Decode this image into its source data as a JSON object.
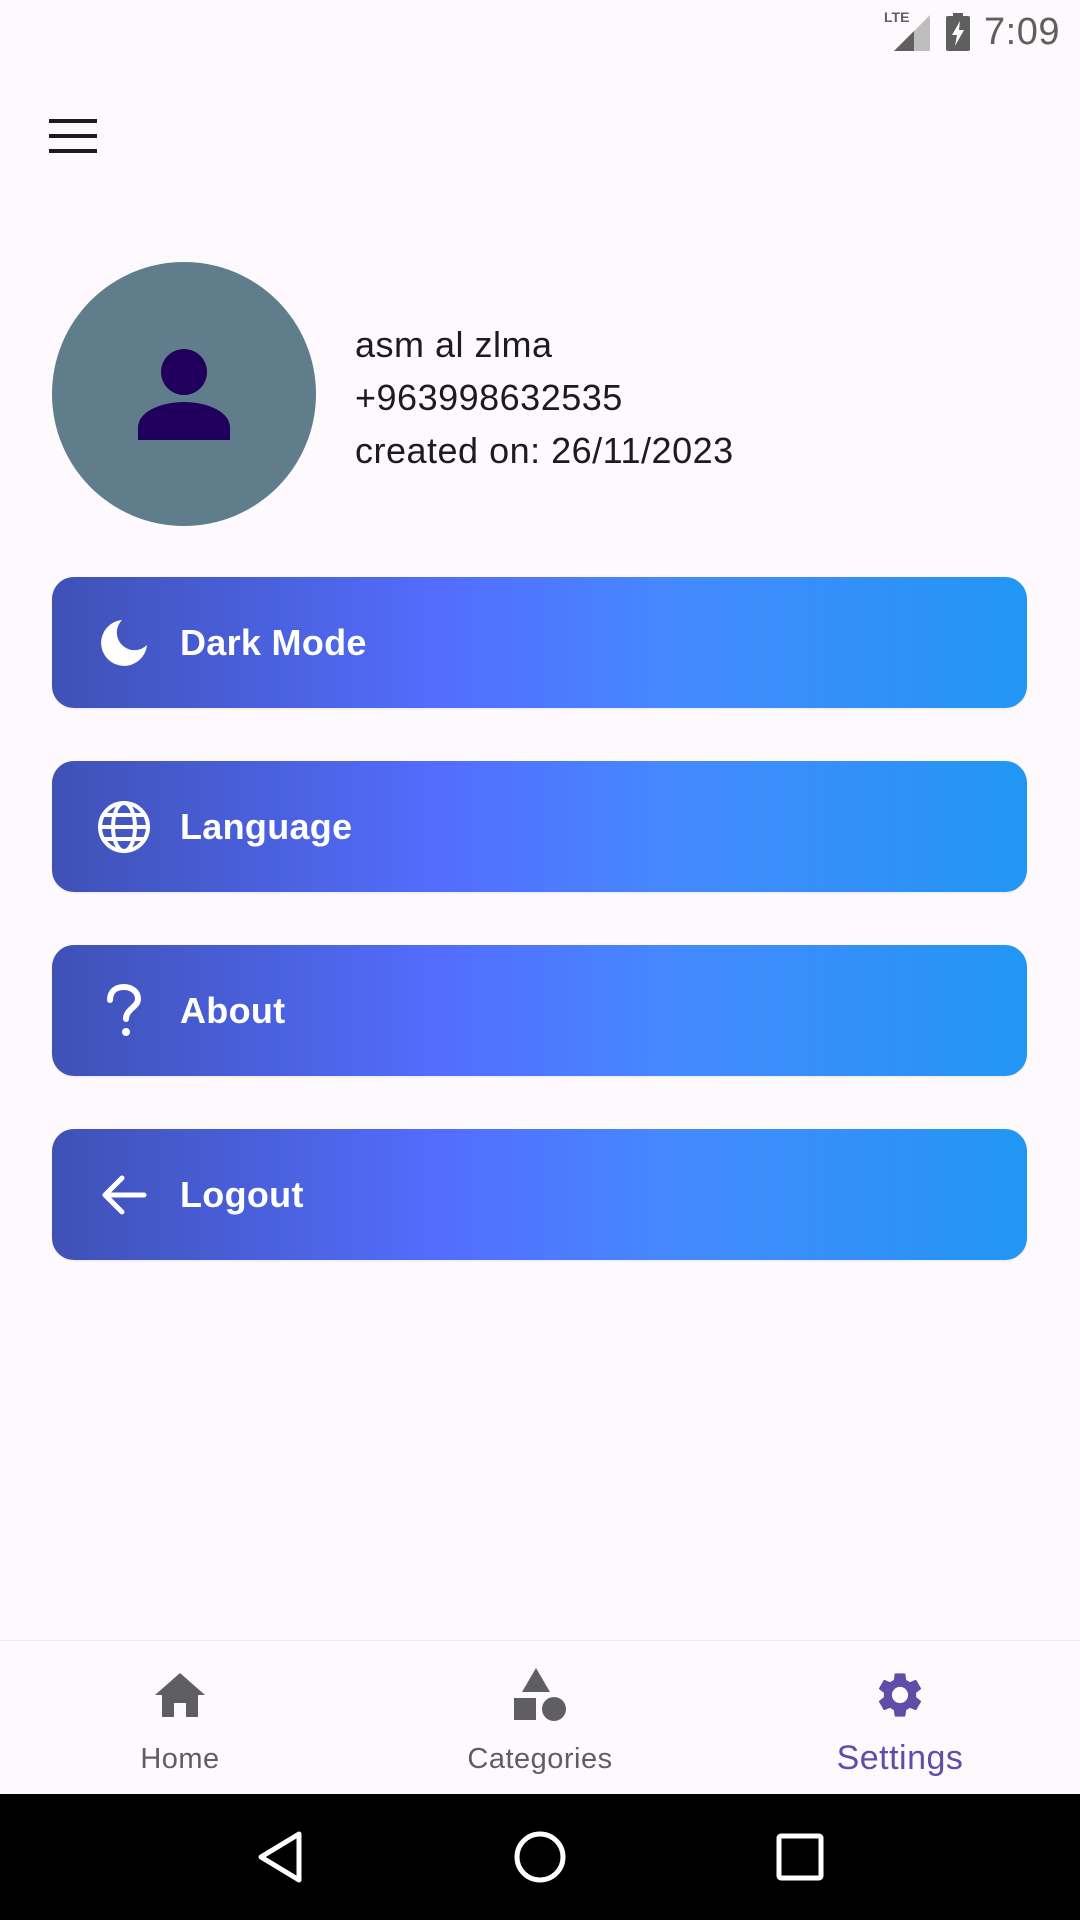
{
  "status_bar": {
    "network": "LTE",
    "time": "7:09"
  },
  "profile": {
    "name": "asm al zlma",
    "phone": "+963998632535",
    "created": "created on: 26/11/2023"
  },
  "menu": [
    {
      "label": "Dark Mode",
      "icon": "moon-icon"
    },
    {
      "label": "Language",
      "icon": "globe-icon"
    },
    {
      "label": "About",
      "icon": "question-icon"
    },
    {
      "label": "Logout",
      "icon": "arrow-left-icon"
    }
  ],
  "bottom_nav": {
    "items": [
      {
        "label": "Home",
        "icon": "home-icon"
      },
      {
        "label": "Categories",
        "icon": "shapes-icon"
      },
      {
        "label": "Settings",
        "icon": "settings-icon"
      }
    ],
    "active": "Settings"
  },
  "colors": {
    "background": "#fdf9fd",
    "avatar_bg": "#607d8b",
    "avatar_icon": "#21005d",
    "gradient_start": "#3f51b5",
    "gradient_mid": "#536dfe",
    "gradient_end": "#2196f3",
    "nav_active": "#5f4ea8",
    "nav_inactive": "#5f5f63"
  }
}
